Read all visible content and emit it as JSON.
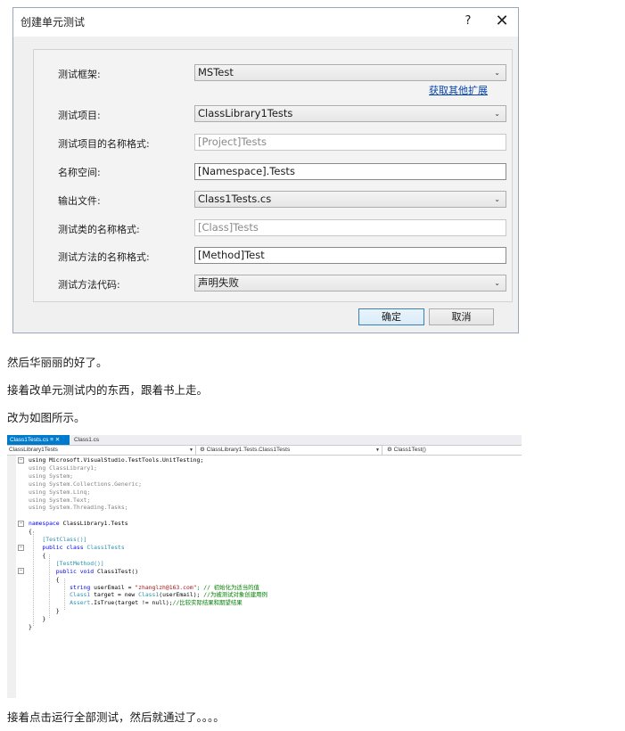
{
  "dialog": {
    "title": "创建单元测试",
    "help": "?",
    "close": "✕",
    "fields": {
      "framework_label": "测试框架:",
      "framework_value": "MSTest",
      "more_link": "获取其他扩展",
      "project_label": "测试项目:",
      "project_value": "ClassLibrary1Tests",
      "project_name_format_label": "测试项目的名称格式:",
      "project_name_format_value": "[Project]Tests",
      "namespace_label": "名称空间:",
      "namespace_value": "[Namespace].Tests",
      "output_file_label": "输出文件:",
      "output_file_value": "Class1Tests.cs",
      "class_name_format_label": "测试类的名称格式:",
      "class_name_format_value": "[Class]Tests",
      "method_name_format_label": "测试方法的名称格式:",
      "method_name_format_value": "[Method]Test",
      "method_code_label": "测试方法代码:",
      "method_code_value": "声明失败"
    },
    "ok": "确定",
    "cancel": "取消"
  },
  "paragraphs": {
    "p1": "然后华丽丽的好了。",
    "p2": "接着改单元测试内的东西，跟着书上走。",
    "p3": "改为如图所示。",
    "p4": "接着点击运行全部测试，然后就通过了。。。。"
  },
  "editor": {
    "tab_active": "Class1Tests.cs  ≡ ✕",
    "tab_inactive": "Class1.cs",
    "nav_project": "ClassLibrary1Tests",
    "nav_class": "ClassLibrary1.Tests.Class1Tests",
    "nav_method": "Class1Test()",
    "code": {
      "l1": "using Microsoft.VisualStudio.TestTools.UnitTesting;",
      "l2": "using ClassLibrary1;",
      "l3": "using System;",
      "l4": "using System.Collections.Generic;",
      "l5": "using System.Linq;",
      "l6": "using System.Text;",
      "l7": "using System.Threading.Tasks;",
      "l9": "namespace ClassLibrary1.Tests",
      "l10": "{",
      "l11": "[TestClass()]",
      "l12a": "public class ",
      "l12b": "Class1Tests",
      "l13": "{",
      "l14": "[TestMethod()]",
      "l15a": "public void ",
      "l15b": "Class1Test()",
      "l16": "{",
      "l17a": "string ",
      "l17b": "userEmail = ",
      "l17c": "\"zhanglzh@163.com\"",
      "l17d": "; // 初始化为适当的值",
      "l18a": "Class1 ",
      "l18b": "target = new ",
      "l18c": "Class1",
      "l18d": "(userEmail); ",
      "l18e": "//为被测试对象创建用例",
      "l19a": "Assert",
      "l19b": ".IsTrue(target != null);",
      "l19c": "//比较实际结果和期望结果",
      "l20": "}",
      "l21": "}",
      "l22": "}"
    }
  }
}
